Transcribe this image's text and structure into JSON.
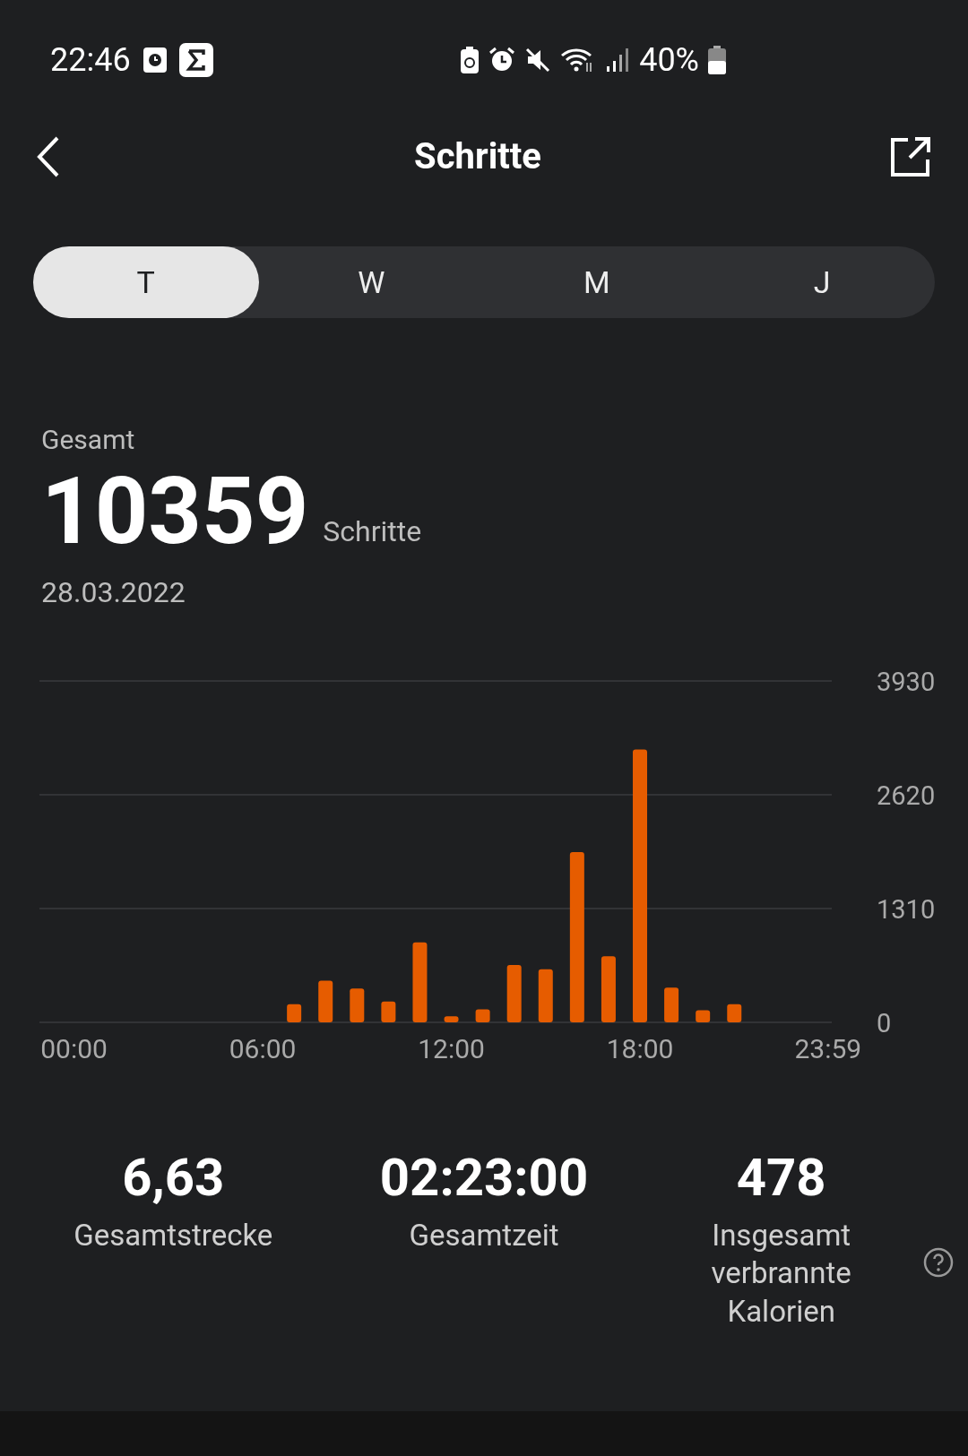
{
  "status_bar": {
    "time": "22:46",
    "battery_percent": "40%"
  },
  "header": {
    "title": "Schritte"
  },
  "period_tabs": [
    {
      "label": "T",
      "selected": true
    },
    {
      "label": "W",
      "selected": false
    },
    {
      "label": "M",
      "selected": false
    },
    {
      "label": "J",
      "selected": false
    }
  ],
  "summary": {
    "label": "Gesamt",
    "value": "10359",
    "unit": "Schritte",
    "date": "28.03.2022"
  },
  "chart_data": {
    "type": "bar",
    "color": "#e65c00",
    "x": [
      7,
      8,
      9,
      10,
      11,
      12,
      13,
      14,
      15,
      16,
      17,
      18,
      19,
      20,
      21
    ],
    "values": [
      210,
      480,
      390,
      240,
      920,
      70,
      150,
      660,
      610,
      1960,
      760,
      3140,
      400,
      140,
      210
    ],
    "xlim": [
      -1.1,
      24.1
    ],
    "ylim": [
      0,
      3930
    ],
    "yticks": [
      0,
      1310,
      2620,
      3930
    ],
    "xticks": [
      {
        "value": 0,
        "label": "00:00"
      },
      {
        "value": 6,
        "label": "06:00"
      },
      {
        "value": 12,
        "label": "12:00"
      },
      {
        "value": 18,
        "label": "18:00"
      },
      {
        "value": 23.98,
        "label": "23:59"
      }
    ]
  },
  "stats": [
    {
      "value": "6,63",
      "label": "Gesamtstrecke"
    },
    {
      "value": "02:23:00",
      "label": "Gesamtzeit"
    },
    {
      "value": "478",
      "label": "Insgesamt verbrannte Kalorien",
      "help": true
    }
  ]
}
